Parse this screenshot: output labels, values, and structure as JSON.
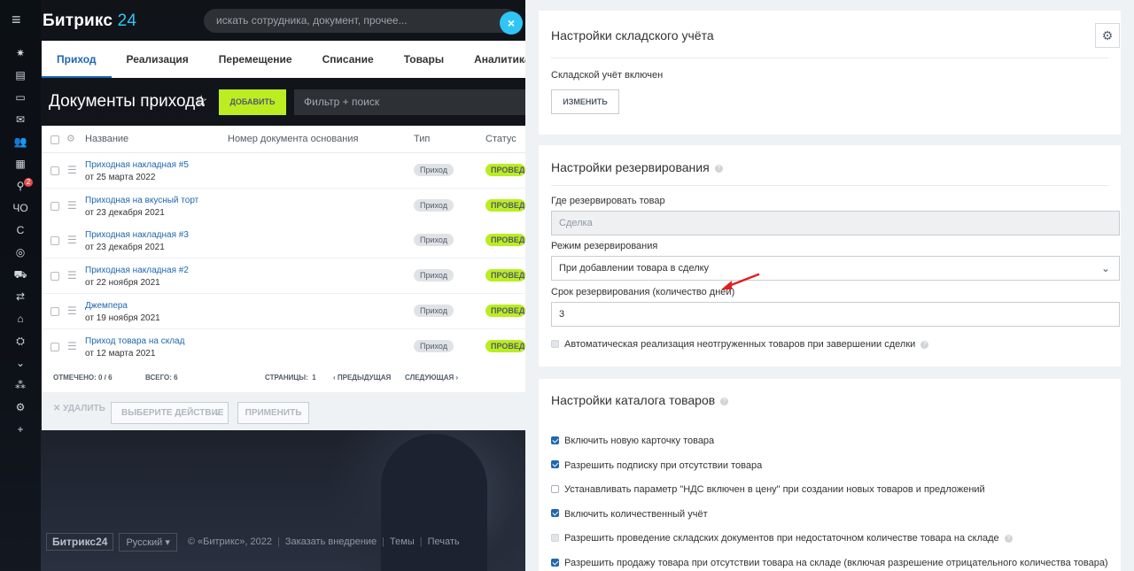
{
  "header": {
    "logo_text": "Битрикс",
    "logo_num": "24",
    "search_placeholder": "искать сотрудника, документ, прочее...",
    "close_glyph": "×"
  },
  "rail": {
    "menu_glyph": "≡",
    "items": [
      {
        "icon": "activity-icon",
        "glyph": "✷"
      },
      {
        "icon": "calendar-icon",
        "glyph": "▤"
      },
      {
        "icon": "drive-icon",
        "glyph": "▭"
      },
      {
        "icon": "mail-icon",
        "glyph": "✉"
      },
      {
        "icon": "groups-icon",
        "glyph": "👥"
      },
      {
        "icon": "docs-icon",
        "glyph": "▦"
      },
      {
        "icon": "filter-icon",
        "glyph": "⚲",
        "badge": "2"
      },
      {
        "icon": "cho-label",
        "glyph": "ЧО"
      },
      {
        "icon": "c-label",
        "glyph": "С"
      },
      {
        "icon": "target-icon",
        "glyph": "◎"
      },
      {
        "icon": "cart-icon",
        "glyph": "⛟"
      },
      {
        "icon": "transfer-icon",
        "glyph": "⇄"
      },
      {
        "icon": "warehouse-icon",
        "glyph": "⌂"
      },
      {
        "icon": "robot-icon",
        "glyph": "⛭"
      },
      {
        "icon": "more-icon",
        "glyph": "⌄"
      },
      {
        "icon": "sitemap-icon",
        "glyph": "⁂"
      },
      {
        "icon": "settings-icon",
        "glyph": "⚙"
      },
      {
        "icon": "add-icon",
        "glyph": "+"
      }
    ]
  },
  "tabs": [
    "Приход",
    "Реализация",
    "Перемещение",
    "Списание",
    "Товары",
    "Аналитика"
  ],
  "page": {
    "title": "Документы прихода",
    "add_label": "ДОБАВИТЬ",
    "filter_placeholder": "Фильтр + поиск"
  },
  "grid": {
    "columns": [
      "Название",
      "Номер документа основания",
      "Тип",
      "Статус"
    ],
    "rows": [
      {
        "name": "Приходная накладная #5",
        "date": "от 25 марта 2022",
        "type": "Приход",
        "status": "ПРОВЕДЕН"
      },
      {
        "name": "Приходная на вкусный торт",
        "date": "от 23 декабря 2021",
        "type": "Приход",
        "status": "ПРОВЕДЕН"
      },
      {
        "name": "Приходная накладная #3",
        "date": "от 23 декабря 2021",
        "type": "Приход",
        "status": "ПРОВЕДЕН"
      },
      {
        "name": "Приходная накладная #2",
        "date": "от 22 ноября 2021",
        "type": "Приход",
        "status": "ПРОВЕДЕН"
      },
      {
        "name": "Джемпера",
        "date": "от 19 ноября 2021",
        "type": "Приход",
        "status": "ПРОВЕДЕН"
      },
      {
        "name": "Приход товара на склад",
        "date": "от 12 марта 2021",
        "type": "Приход",
        "status": "ПРОВЕДЕН"
      }
    ],
    "footer": {
      "checked_label": "ОТМЕЧЕНО:",
      "checked_value": "0 / 6",
      "total_label": "ВСЕГО:",
      "total_value": "6",
      "pages_label": "СТРАНИЦЫ:",
      "pages_value": "1",
      "prev": "‹ ПРЕДЫДУЩАЯ",
      "next": "СЛЕДУЮЩАЯ ›"
    },
    "actions": {
      "delete": "✕ УДАЛИТЬ",
      "select_action": "ВЫБЕРИТЕ ДЕЙСТВИЕ",
      "apply": "ПРИМЕНИТЬ"
    }
  },
  "footer": {
    "logo": "Битрикс24",
    "lang": "Русский",
    "copyright": "© «Битрикс», 2022",
    "order": "Заказать внедрение",
    "themes": "Темы",
    "print": "Печать"
  },
  "slider": {
    "warehouse": {
      "title": "Настройки складского учёта",
      "status": "Складской учёт включен",
      "change_label": "ИЗМЕНИТЬ"
    },
    "reserve": {
      "title": "Настройки резервирования",
      "where_label": "Где резервировать товар",
      "where_value": "Сделка",
      "mode_label": "Режим резервирования",
      "mode_value": "При добавлении товара в сделку",
      "period_label": "Срок резервирования (количество дней)",
      "period_value": "3",
      "auto_label": "Автоматическая реализация неотгруженных товаров при завершении сделки"
    },
    "catalog": {
      "title": "Настройки каталога товаров",
      "options": [
        {
          "label": "Включить новую карточку товара",
          "state": "on"
        },
        {
          "label": "Разрешить подписку при отсутствии товара",
          "state": "on"
        },
        {
          "label": "Устанавливать параметр \"НДС включен в цену\" при создании новых товаров и предложений",
          "state": "off"
        },
        {
          "label": "Включить количественный учёт",
          "state": "on"
        },
        {
          "label": "Разрешить проведение складских документов при недостаточном количестве товара на складе",
          "state": "dis",
          "help": true
        },
        {
          "label": "Разрешить продажу товара при отсутствии товара на складе (включая разрешение отрицательного количества товара)",
          "state": "on"
        }
      ]
    },
    "accent": "#2067b0",
    "annotation_arrow_color": "#e02020"
  }
}
